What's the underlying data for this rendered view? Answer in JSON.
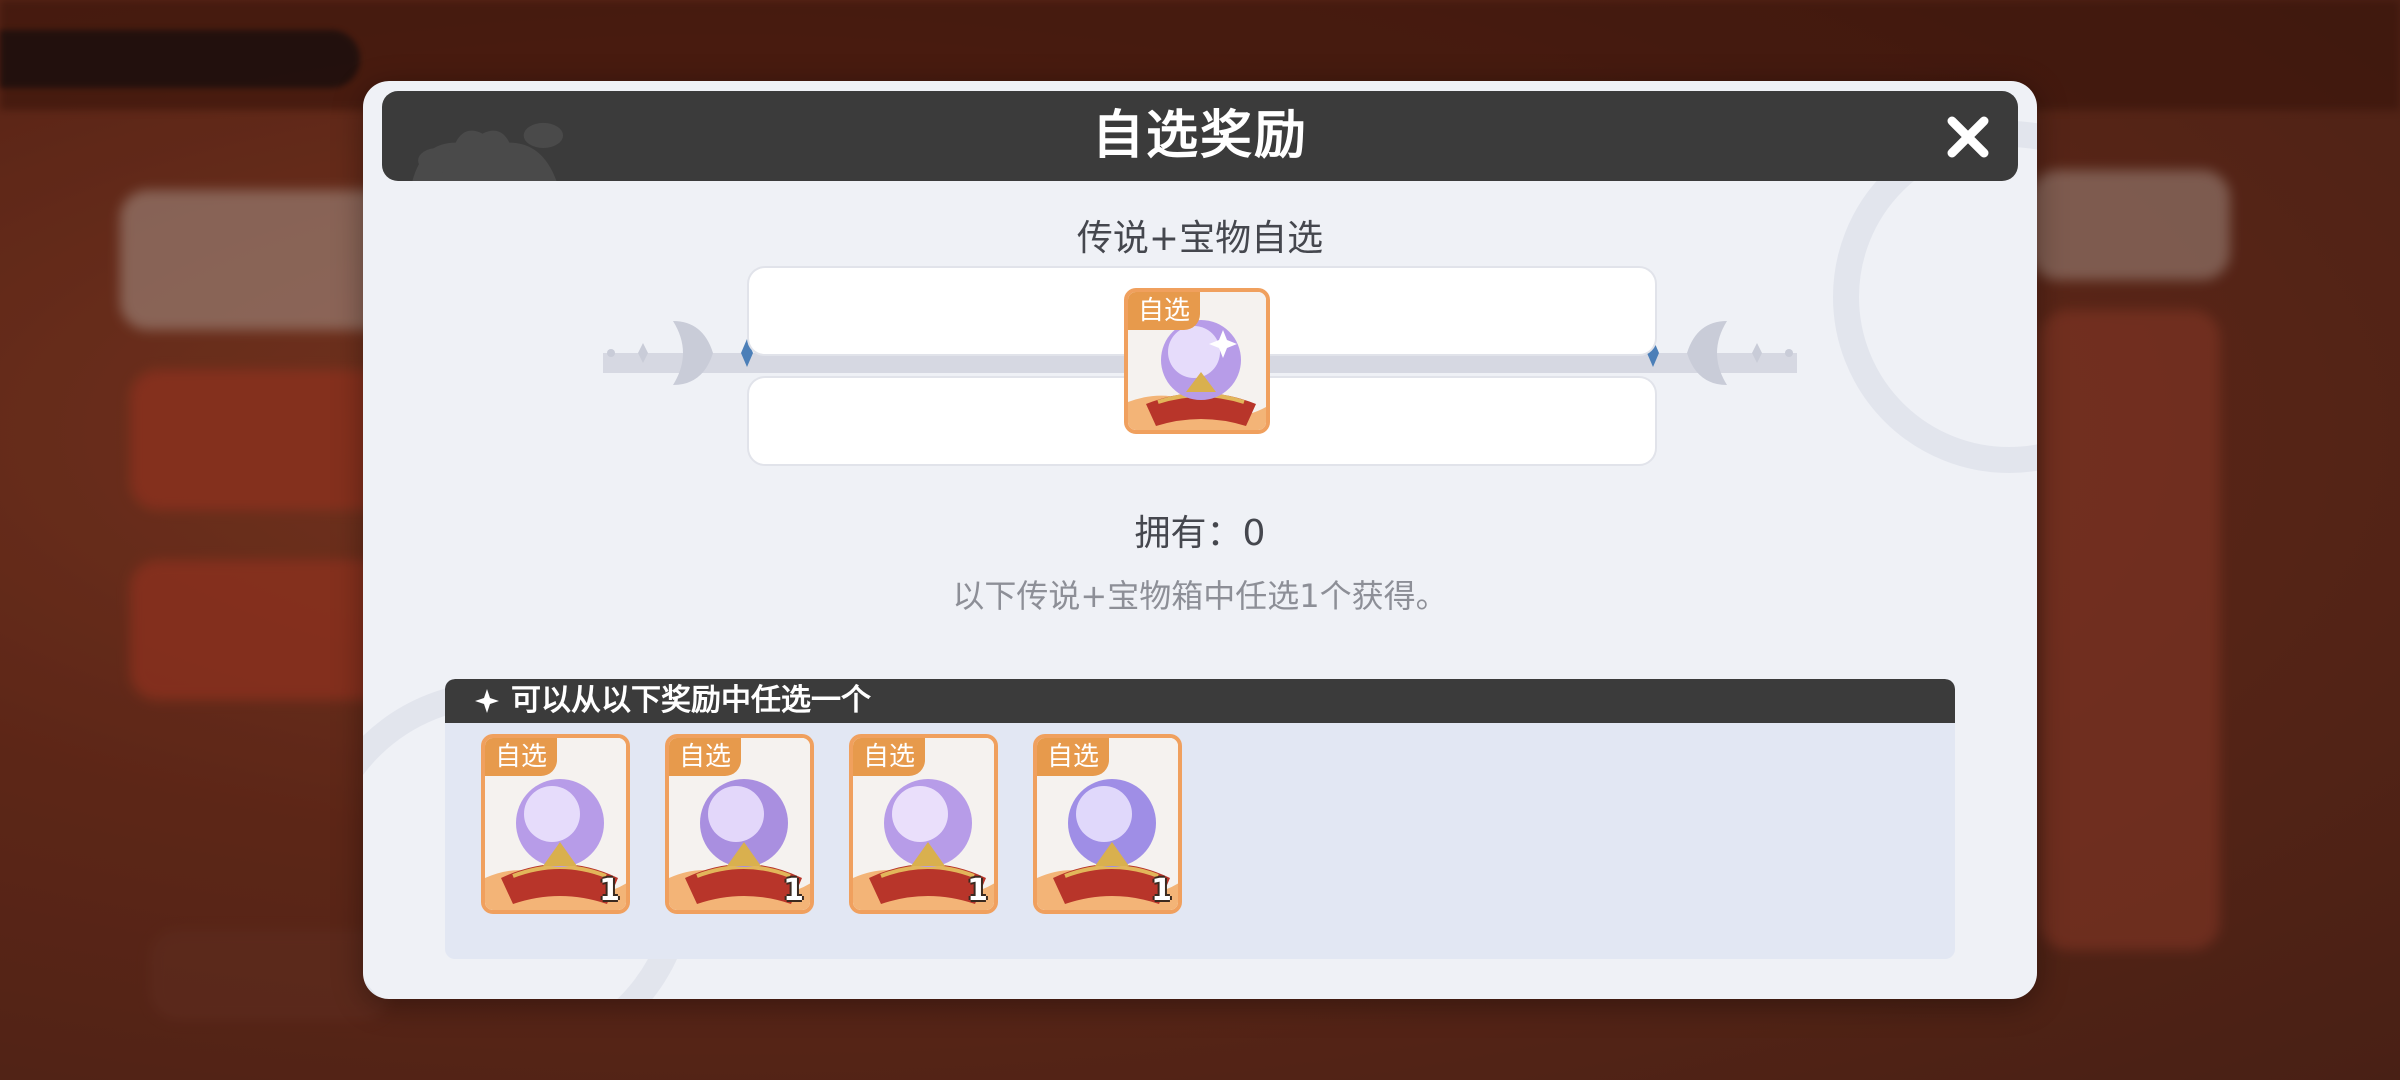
{
  "dialog": {
    "title": "自选奖励",
    "subtitle": "传说+宝物自选",
    "owned_label": "拥有：0",
    "hint": "以下传说+宝物箱中任选1个获得。",
    "featured_item": {
      "tag": "自选",
      "icon": "crystal-ball-icon"
    }
  },
  "rewards": {
    "header_label": "可以从以下奖励中任选一个",
    "items": [
      {
        "tag": "自选",
        "count": "1",
        "icon": "crystal-ball-icon"
      },
      {
        "tag": "自选",
        "count": "1",
        "icon": "crystal-ball-icon"
      },
      {
        "tag": "自选",
        "count": "1",
        "icon": "crystal-ball-icon"
      },
      {
        "tag": "自选",
        "count": "1",
        "icon": "crystal-ball-icon"
      }
    ]
  },
  "colors": {
    "dialog_bg": "#eff1f6",
    "header_bg": "#3b3b3b",
    "item_border": "#f0a05e",
    "tag_bg": "#e79a4c"
  }
}
